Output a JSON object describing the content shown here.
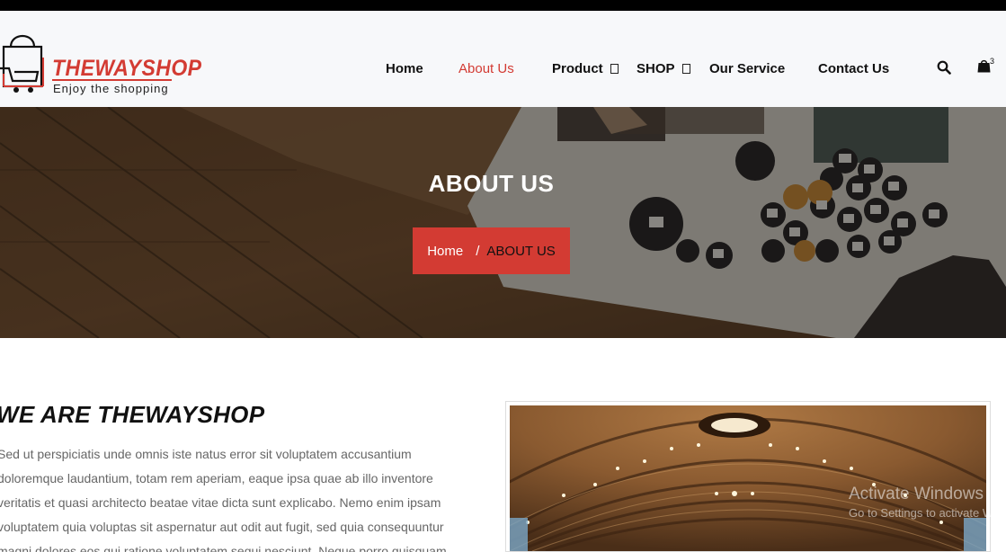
{
  "brand": {
    "name": "THEWAYSHOP",
    "tagline": "Enjoy the shopping",
    "accent_color": "#d33b33"
  },
  "nav": {
    "items": [
      {
        "label": "Home",
        "active": false,
        "has_dropdown": false
      },
      {
        "label": "About Us",
        "active": true,
        "has_dropdown": false
      },
      {
        "label": "Product",
        "active": false,
        "has_dropdown": true
      },
      {
        "label": "SHOP",
        "active": false,
        "has_dropdown": true
      },
      {
        "label": "Our Service",
        "active": false,
        "has_dropdown": false
      },
      {
        "label": "Contact Us",
        "active": false,
        "has_dropdown": false
      }
    ],
    "icons": {
      "search": "search-icon",
      "cart": "shopping-bag-icon"
    },
    "cart_count": "3"
  },
  "banner": {
    "title": "ABOUT US",
    "breadcrumb": {
      "home": "Home",
      "separator": "/",
      "current": "ABOUT US"
    }
  },
  "about": {
    "heading": "WE ARE THEWAYSHOP",
    "lines": [
      "Sed ut perspiciatis unde omnis iste natus error sit voluptatem accusantium",
      "doloremque laudantium, totam rem aperiam, eaque ipsa quae ab illo inventore",
      "veritatis et quasi architecto beatae vitae dicta sunt explicabo. Nemo enim ipsam",
      "voluptatem quia voluptas sit aspernatur aut odit aut fugit, sed quia consequuntur",
      "magni dolores eos qui ratione voluptatem sequi nesciunt. Neque porro quisquam"
    ]
  },
  "watermark": {
    "line1": "Activate Windows",
    "line2": "Go to Settings to activate W"
  }
}
